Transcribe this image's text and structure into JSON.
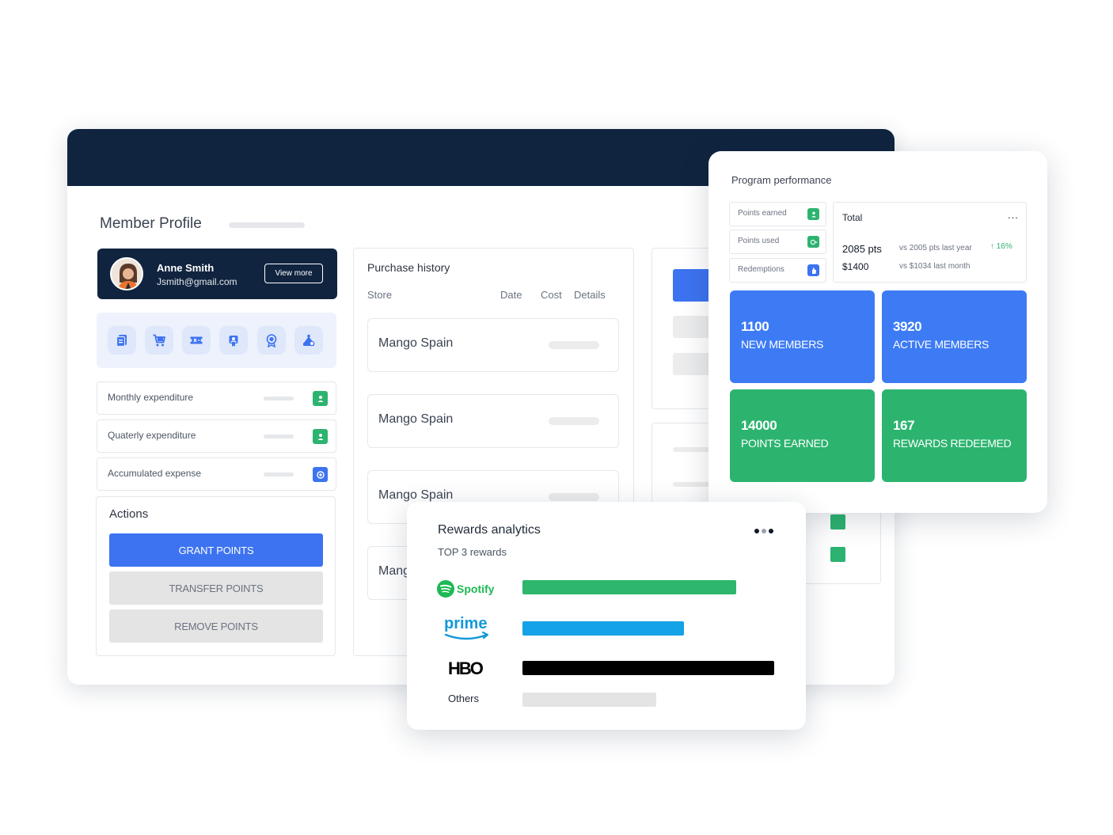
{
  "member_profile": {
    "title": "Member Profile",
    "profile": {
      "name": "Anne Smith",
      "email": "Jsmith@gmail.com",
      "view_more_label": "View more"
    },
    "quick_icons": [
      "document-icon",
      "cart-icon",
      "ticket-icon",
      "badge-icon",
      "award-icon",
      "gift-icon"
    ],
    "stats": [
      {
        "label": "Monthly expenditure",
        "icon": "user-download-icon",
        "color": "#2db370"
      },
      {
        "label": "Quaterly  expenditure",
        "icon": "user-download-icon",
        "color": "#2db370"
      },
      {
        "label": "Accumulated  expense",
        "icon": "coin-icon",
        "color": "#3d73f0"
      }
    ],
    "actions": {
      "title": "Actions",
      "buttons": [
        "GRANT POINTS",
        "TRANSFER POINTS",
        "REMOVE POINTS"
      ]
    }
  },
  "purchase_history": {
    "title": "Purchase history",
    "columns": {
      "store": "Store",
      "date": "Date",
      "cost": "Cost",
      "details": "Details"
    },
    "rows": [
      "Mango Spain",
      "Mango Spain",
      "Mango Spain",
      "Mango"
    ]
  },
  "program_performance": {
    "title": "Program performance",
    "metrics": [
      {
        "label": "Points earned",
        "icon": "user-download-icon",
        "color": "#2db370"
      },
      {
        "label": "Points used",
        "icon": "coin-out-icon",
        "color": "#2db370"
      },
      {
        "label": "Redemptions",
        "icon": "hand-icon",
        "color": "#3d73f0"
      }
    ],
    "total": {
      "label": "Total",
      "menu": "...",
      "points": "2085 pts",
      "points_compare": "vs 2005 pts last year",
      "growth": "16%",
      "amount": "$1400",
      "amount_compare": "vs $1034 last month"
    },
    "tiles": [
      {
        "value": "1100",
        "label": "NEW MEMBERS",
        "color": "#3d7bf5"
      },
      {
        "value": "3920",
        "label": "ACTIVE MEMBERS",
        "color": "#3d7bf5"
      },
      {
        "value": "14000",
        "label": "POINTS EARNED",
        "color": "#2cb46f"
      },
      {
        "value": "167",
        "label": "REWARDS REDEEMED",
        "color": "#2cb46f"
      }
    ]
  },
  "rewards_analytics": {
    "title": "Rewards analytics",
    "subtitle": "TOP 3 rewards",
    "rewards": [
      {
        "brand": "Spotify",
        "logo": "spotify-logo",
        "share": 0.85,
        "color": "#2eb66c"
      },
      {
        "brand": "prime",
        "logo": "amazon-prime-logo",
        "share": 0.64,
        "color": "#15a2e6"
      },
      {
        "brand": "HBO",
        "logo": "hbo-logo",
        "share": 1.0,
        "color": "#000000"
      },
      {
        "brand": "Others",
        "logo": "",
        "share": 0.53,
        "color": "#e4e4e4"
      }
    ]
  }
}
